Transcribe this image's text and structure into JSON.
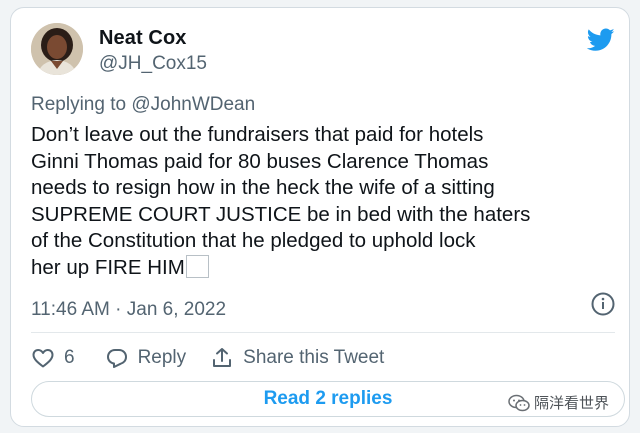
{
  "user": {
    "display_name": "Neat Cox",
    "handle": "@JH_Cox15",
    "avatar_icon": "profile-photo"
  },
  "brand": {
    "icon": "twitter-bird-icon",
    "color": "#1d9bf0"
  },
  "tweet": {
    "replying_to": "Replying to @JohnWDean",
    "lines": [
      "Don’t leave out the fundraisers that paid for hotels",
      "Ginni Thomas paid for 80 buses Clarence Thomas",
      "needs to resign how in the heck the wife of a sitting",
      "SUPREME COURT JUSTICE be in bed with the haters",
      "of the Constitution that he pledged to uphold lock",
      "her up FIRE HIM"
    ],
    "timestamp": "11:46 AM · Jan 6, 2022"
  },
  "actions": {
    "like_count": "6",
    "reply_label": "Reply",
    "share_label": "Share this Tweet"
  },
  "read_replies": "Read 2 replies",
  "watermark": "隔洋看世界"
}
